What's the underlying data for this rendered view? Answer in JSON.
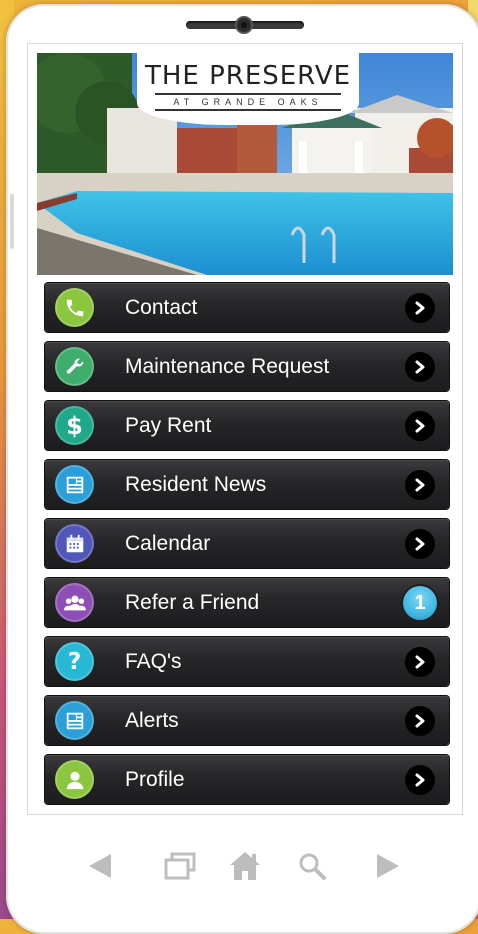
{
  "app": {
    "logo_title": "THE PRESERVE",
    "logo_subtitle": "AT GRANDE OAKS"
  },
  "menu": {
    "items": [
      {
        "label": "Contact",
        "icon": "phone-icon",
        "color": "#8cc63e"
      },
      {
        "label": "Maintenance Request",
        "icon": "wrench-icon",
        "color": "#3fae6c"
      },
      {
        "label": "Pay Rent",
        "icon": "dollar-icon",
        "color": "#1fa88a"
      },
      {
        "label": "Resident News",
        "icon": "newspaper-icon",
        "color": "#2a9fd8"
      },
      {
        "label": "Calendar",
        "icon": "calendar-icon",
        "color": "#5057b8"
      },
      {
        "label": "Refer a Friend",
        "icon": "group-icon",
        "color": "#8d4fb5",
        "badge": "1"
      },
      {
        "label": "FAQ's",
        "icon": "question-icon",
        "color": "#27b8d6"
      },
      {
        "label": "Alerts",
        "icon": "newspaper-icon",
        "color": "#2a9fd8"
      },
      {
        "label": "Profile",
        "icon": "user-icon",
        "color": "#8cc63e"
      }
    ]
  },
  "navbar": {
    "icons": [
      "back-arrow-icon",
      "windows-icon",
      "home-icon",
      "search-icon",
      "forward-arrow-icon"
    ],
    "color": "#bdbdbd"
  }
}
